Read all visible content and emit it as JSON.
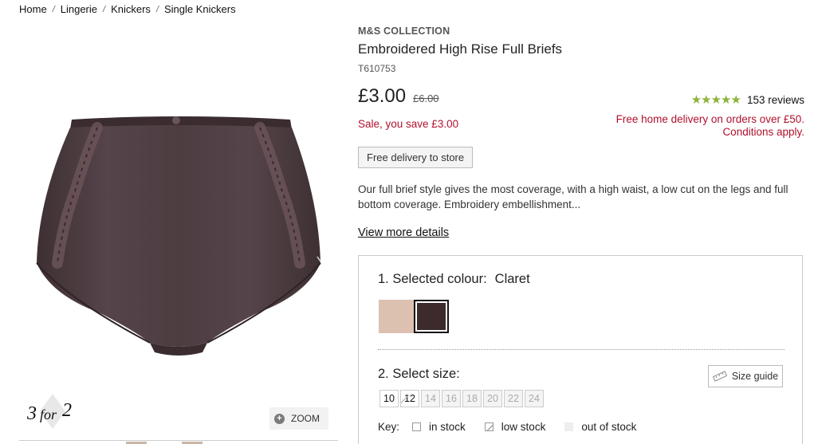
{
  "breadcrumb": [
    "Home",
    "Lingerie",
    "Knickers",
    "Single Knickers"
  ],
  "breadcrumb_separator": "/",
  "product": {
    "brand": "M&S COLLECTION",
    "title": "Embroidered High Rise Full Briefs",
    "sku": "T610753",
    "price": "£3.00",
    "old_price": "£6.00",
    "saving": "Sale, you save £3.00",
    "rating_stars": 4.5,
    "reviews": "153 reviews",
    "delivery_note_line1": "Free home delivery on orders over £50.",
    "delivery_note_line2": "Conditions apply.",
    "delivery_button": "Free delivery to store",
    "description": "Our full brief style gives the most coverage, with a high waist, a low cut on the legs and full bottom coverage. Embroidery embellishment...",
    "more_details": "View more details"
  },
  "image": {
    "offer_badge": "3 for 2",
    "zoom_label": "ZOOM",
    "product_color": "#4a3a3c"
  },
  "options": {
    "colour_heading": "1. Selected colour:",
    "colour_value": "Claret",
    "swatches": [
      {
        "name": "nude",
        "color": "#dcc0b0",
        "selected": false
      },
      {
        "name": "claret",
        "color": "#3c2a2d",
        "selected": true
      }
    ],
    "size_heading": "2. Select size:",
    "size_guide": "Size guide",
    "sizes": [
      {
        "label": "10",
        "state": "in"
      },
      {
        "label": "12",
        "state": "low"
      },
      {
        "label": "14",
        "state": "out"
      },
      {
        "label": "16",
        "state": "out"
      },
      {
        "label": "18",
        "state": "out"
      },
      {
        "label": "20",
        "state": "out"
      },
      {
        "label": "22",
        "state": "out"
      },
      {
        "label": "24",
        "state": "out"
      }
    ],
    "key_label": "Key:",
    "key_in": "in stock",
    "key_low": "low stock",
    "key_out": "out of stock"
  },
  "colors": {
    "sale_red": "#b0112d",
    "star_green": "#8db43c"
  }
}
